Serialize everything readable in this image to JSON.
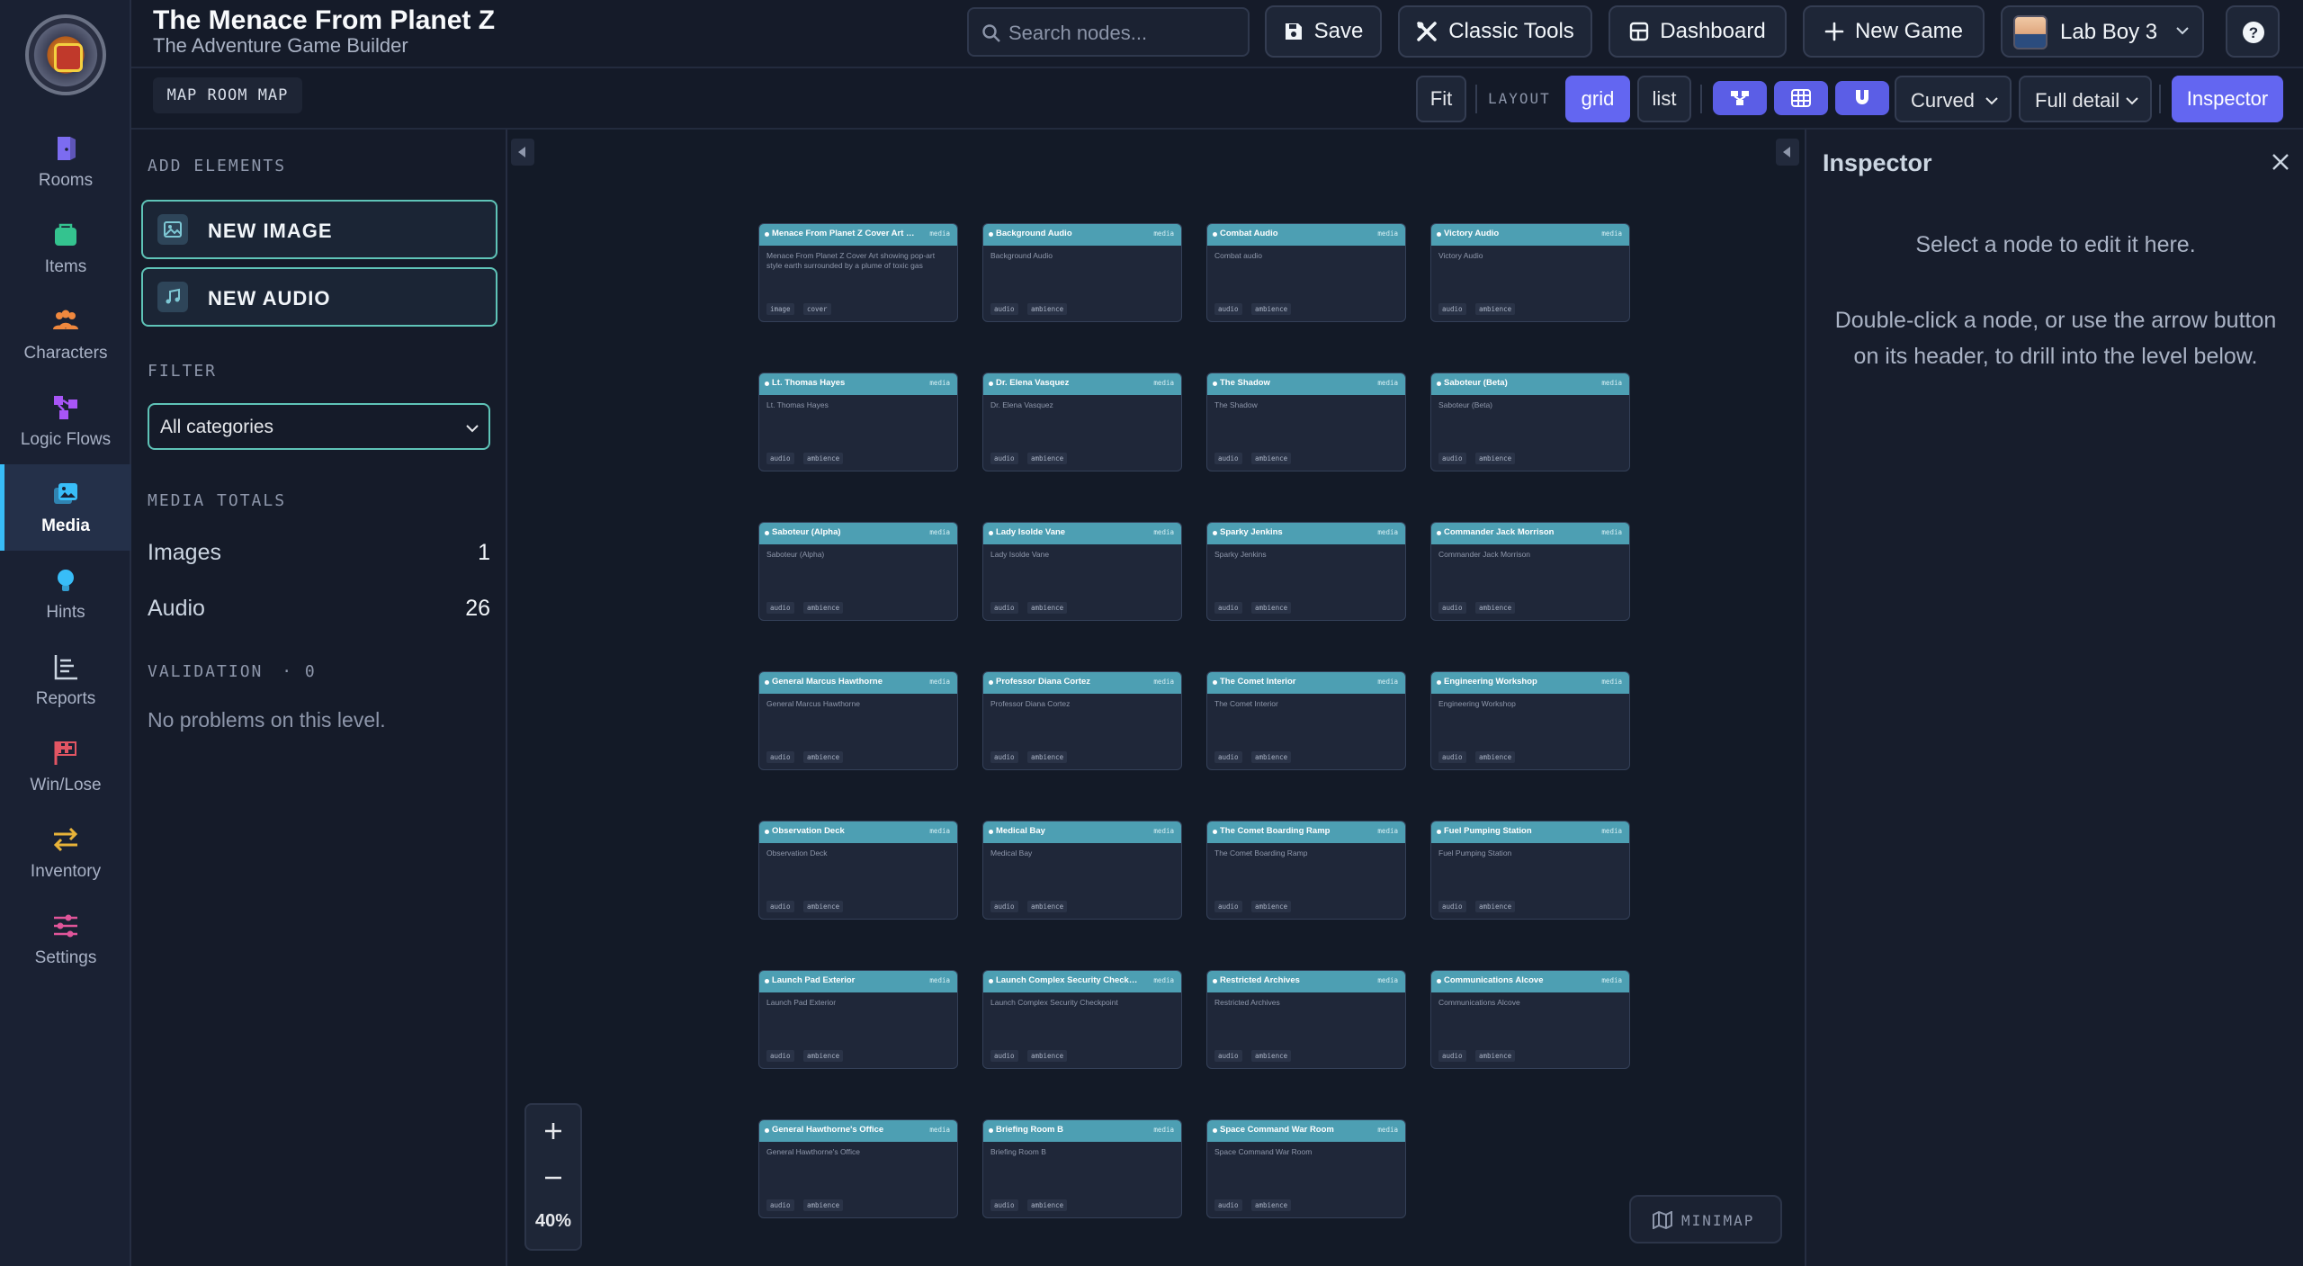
{
  "app": {
    "title": "The Menace From Planet Z",
    "subtitle": "The Adventure Game Builder"
  },
  "search": {
    "placeholder": "Search nodes..."
  },
  "header_buttons": {
    "save": "Save",
    "classic_tools": "Classic Tools",
    "dashboard": "Dashboard",
    "new_game": "New Game",
    "user": "Lab Boy 3",
    "help": "?"
  },
  "nav": [
    {
      "label": "Rooms",
      "icon": "door-icon",
      "color": "#7c6cf0"
    },
    {
      "label": "Items",
      "icon": "bag-icon",
      "color": "#34c38f"
    },
    {
      "label": "Characters",
      "icon": "people-icon",
      "color": "#f0883e"
    },
    {
      "label": "Logic Flows",
      "icon": "flow-icon",
      "color": "#a855f7"
    },
    {
      "label": "Media",
      "icon": "image-icon",
      "color": "#38bdf8",
      "active": true
    },
    {
      "label": "Hints",
      "icon": "bulb-icon",
      "color": "#38bdf8"
    },
    {
      "label": "Reports",
      "icon": "report-icon",
      "color": "#cbd5e1"
    },
    {
      "label": "Win/Lose",
      "icon": "flag-icon",
      "color": "#e25563"
    },
    {
      "label": "Inventory",
      "icon": "swap-icon",
      "color": "#e8b339"
    },
    {
      "label": "Settings",
      "icon": "sliders-icon",
      "color": "#e0559a"
    }
  ],
  "toolbar": {
    "map_label": "MAP ROOM MAP",
    "fit": "Fit",
    "layout_label": "LAYOUT",
    "grid": "grid",
    "list": "list",
    "edge_style": "Curved",
    "detail": "Full detail",
    "inspector": "Inspector"
  },
  "left_panel": {
    "add_title": "ADD ELEMENTS",
    "new_image": "NEW IMAGE",
    "new_audio": "NEW AUDIO",
    "filter_title": "FILTER",
    "filter_value": "All categories",
    "totals_title": "MEDIA TOTALS",
    "totals": [
      {
        "label": "Images",
        "value": "1"
      },
      {
        "label": "Audio",
        "value": "26"
      }
    ],
    "validation_title": "VALIDATION",
    "validation_count": "· 0",
    "validation_msg": "No problems on this level."
  },
  "canvas": {
    "zoom": "40%",
    "zoom_in": "+",
    "zoom_out": "−",
    "minimap": "MINIMAP",
    "node_type": "media",
    "nodes": [
      {
        "title": "Menace From Planet Z Cover Art sh...",
        "desc": "Menace From Planet Z Cover Art showing pop-art style earth surrounded by a plume of toxic gas",
        "tags": [
          "image",
          "cover"
        ]
      },
      {
        "title": "Background Audio",
        "desc": "Background Audio",
        "tags": [
          "audio",
          "ambience"
        ]
      },
      {
        "title": "Combat Audio",
        "desc": "Combat audio",
        "tags": [
          "audio",
          "ambience"
        ]
      },
      {
        "title": "Victory Audio",
        "desc": "Victory Audio",
        "tags": [
          "audio",
          "ambience"
        ]
      },
      {
        "title": "Lt. Thomas Hayes",
        "desc": "Lt. Thomas Hayes",
        "tags": [
          "audio",
          "ambience"
        ]
      },
      {
        "title": "Dr. Elena Vasquez",
        "desc": "Dr. Elena Vasquez",
        "tags": [
          "audio",
          "ambience"
        ]
      },
      {
        "title": "The Shadow",
        "desc": "The Shadow",
        "tags": [
          "audio",
          "ambience"
        ]
      },
      {
        "title": "Saboteur (Beta)",
        "desc": "Saboteur (Beta)",
        "tags": [
          "audio",
          "ambience"
        ]
      },
      {
        "title": "Saboteur (Alpha)",
        "desc": "Saboteur (Alpha)",
        "tags": [
          "audio",
          "ambience"
        ]
      },
      {
        "title": "Lady Isolde Vane",
        "desc": "Lady Isolde Vane",
        "tags": [
          "audio",
          "ambience"
        ]
      },
      {
        "title": "Sparky Jenkins",
        "desc": "Sparky Jenkins",
        "tags": [
          "audio",
          "ambience"
        ]
      },
      {
        "title": "Commander Jack Morrison",
        "desc": "Commander Jack Morrison",
        "tags": [
          "audio",
          "ambience"
        ]
      },
      {
        "title": "General Marcus Hawthorne",
        "desc": "General Marcus Hawthorne",
        "tags": [
          "audio",
          "ambience"
        ]
      },
      {
        "title": "Professor Diana Cortez",
        "desc": "Professor Diana Cortez",
        "tags": [
          "audio",
          "ambience"
        ]
      },
      {
        "title": "The Comet Interior",
        "desc": "The Comet Interior",
        "tags": [
          "audio",
          "ambience"
        ]
      },
      {
        "title": "Engineering Workshop",
        "desc": "Engineering Workshop",
        "tags": [
          "audio",
          "ambience"
        ]
      },
      {
        "title": "Observation Deck",
        "desc": "Observation Deck",
        "tags": [
          "audio",
          "ambience"
        ]
      },
      {
        "title": "Medical Bay",
        "desc": "Medical Bay",
        "tags": [
          "audio",
          "ambience"
        ]
      },
      {
        "title": "The Comet Boarding Ramp",
        "desc": "The Comet Boarding Ramp",
        "tags": [
          "audio",
          "ambience"
        ]
      },
      {
        "title": "Fuel Pumping Station",
        "desc": "Fuel Pumping Station",
        "tags": [
          "audio",
          "ambience"
        ]
      },
      {
        "title": "Launch Pad Exterior",
        "desc": "Launch Pad Exterior",
        "tags": [
          "audio",
          "ambience"
        ]
      },
      {
        "title": "Launch Complex Security Checkpoint",
        "desc": "Launch Complex Security Checkpoint",
        "tags": [
          "audio",
          "ambience"
        ]
      },
      {
        "title": "Restricted Archives",
        "desc": "Restricted Archives",
        "tags": [
          "audio",
          "ambience"
        ]
      },
      {
        "title": "Communications Alcove",
        "desc": "Communications Alcove",
        "tags": [
          "audio",
          "ambience"
        ]
      },
      {
        "title": "General Hawthorne's Office",
        "desc": "General Hawthorne's Office",
        "tags": [
          "audio",
          "ambience"
        ]
      },
      {
        "title": "Briefing Room B",
        "desc": "Briefing Room B",
        "tags": [
          "audio",
          "ambience"
        ]
      },
      {
        "title": "Space Command War Room",
        "desc": "Space Command War Room",
        "tags": [
          "audio",
          "ambience"
        ]
      }
    ]
  },
  "inspector": {
    "title": "Inspector",
    "msg1": "Select a node to edit it here.",
    "msg2": "Double-click a node, or use the arrow button on its header, to drill into the level below."
  }
}
